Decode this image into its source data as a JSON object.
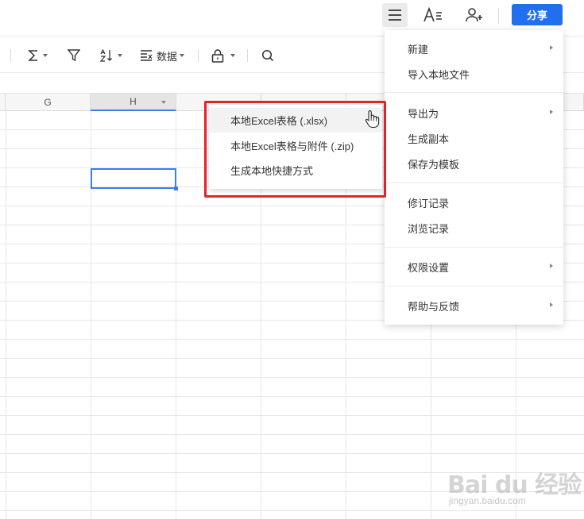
{
  "header": {
    "share_label": "分享",
    "icons": [
      "menu-icon",
      "font-style-icon",
      "add-user-icon"
    ]
  },
  "toolbar": {
    "items": [
      "sum-icon",
      "filter-icon",
      "sort-icon",
      "data-icon",
      "lock-icon",
      "search-icon"
    ],
    "data_label": "数据"
  },
  "sheet": {
    "columns": [
      "G",
      "H"
    ],
    "selected_column": "H"
  },
  "main_menu": {
    "items": [
      {
        "label": "新建",
        "submenu": true
      },
      {
        "label": "导入本地文件",
        "submenu": false
      },
      {
        "label": "导出为",
        "submenu": true
      },
      {
        "label": "生成副本",
        "submenu": false
      },
      {
        "label": "保存为模板",
        "submenu": false
      },
      {
        "label": "修订记录",
        "submenu": false
      },
      {
        "label": "浏览记录",
        "submenu": false
      },
      {
        "label": "权限设置",
        "submenu": true
      },
      {
        "label": "帮助与反馈",
        "submenu": true
      }
    ]
  },
  "export_submenu": {
    "items": [
      {
        "label": "本地Excel表格 (.xlsx)"
      },
      {
        "label": "本地Excel表格与附件 (.zip)"
      },
      {
        "label": "生成本地快捷方式"
      }
    ]
  },
  "watermark": {
    "logo_text": "Bai du 经验",
    "url": "jingyan.baidu.com"
  },
  "colors": {
    "accent": "#1f6fef",
    "highlight": "#e2242b",
    "selection": "#3b7df0"
  }
}
